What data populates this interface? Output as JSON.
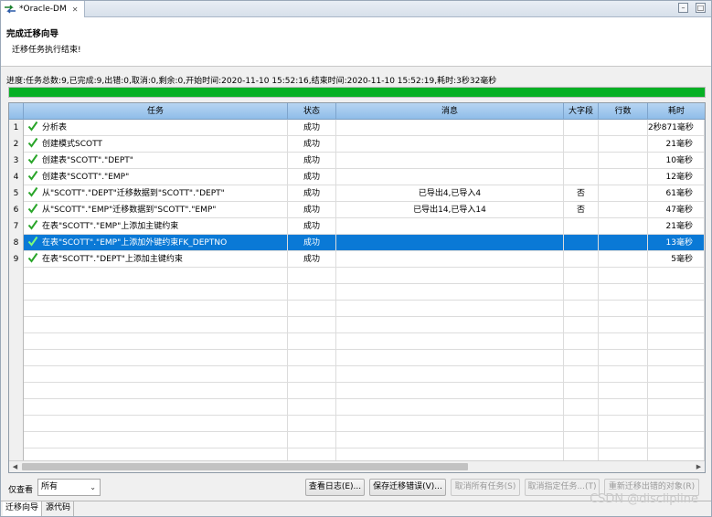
{
  "window": {
    "tab_title": "*Oracle-DM",
    "close_glyph": "✕",
    "minimize_glyph": "–",
    "maximize_glyph": "□"
  },
  "header": {
    "title": "完成迁移向导",
    "subtitle": "迁移任务执行结束!"
  },
  "progress": {
    "text": "进度:任务总数:9,已完成:9,出错:0,取消:0,剩余:0,开始时间:2020-11-10 15:52:16,结束时间:2020-11-10 15:52:19,耗时:3秒32毫秒",
    "fraction": 1.0,
    "color": "#06b025"
  },
  "table": {
    "columns": [
      "任务",
      "状态",
      "消息",
      "大字段",
      "行数",
      "耗时"
    ],
    "rows": [
      {
        "num": "1",
        "task": "分析表",
        "status": "成功",
        "message": "",
        "big": "",
        "rows": "",
        "time": "2秒871毫秒"
      },
      {
        "num": "2",
        "task": "创建模式SCOTT",
        "status": "成功",
        "message": "",
        "big": "",
        "rows": "",
        "time": "21毫秒"
      },
      {
        "num": "3",
        "task": "创建表\"SCOTT\".\"DEPT\"",
        "status": "成功",
        "message": "",
        "big": "",
        "rows": "",
        "time": "10毫秒"
      },
      {
        "num": "4",
        "task": "创建表\"SCOTT\".\"EMP\"",
        "status": "成功",
        "message": "",
        "big": "",
        "rows": "",
        "time": "12毫秒"
      },
      {
        "num": "5",
        "task": "从\"SCOTT\".\"DEPT\"迁移数据到\"SCOTT\".\"DEPT\"",
        "status": "成功",
        "message": "已导出4,已导入4",
        "big": "否",
        "rows": "",
        "time": "61毫秒"
      },
      {
        "num": "6",
        "task": "从\"SCOTT\".\"EMP\"迁移数据到\"SCOTT\".\"EMP\"",
        "status": "成功",
        "message": "已导出14,已导入14",
        "big": "否",
        "rows": "",
        "time": "47毫秒"
      },
      {
        "num": "7",
        "task": "在表\"SCOTT\".\"EMP\"上添加主键约束",
        "status": "成功",
        "message": "",
        "big": "",
        "rows": "",
        "time": "21毫秒"
      },
      {
        "num": "8",
        "task": "在表\"SCOTT\".\"EMP\"上添加外键约束FK_DEPTNO",
        "status": "成功",
        "message": "",
        "big": "",
        "rows": "",
        "time": "13毫秒",
        "selected": true
      },
      {
        "num": "9",
        "task": "在表\"SCOTT\".\"DEPT\"上添加主键约束",
        "status": "成功",
        "message": "",
        "big": "",
        "rows": "",
        "time": "5毫秒"
      }
    ],
    "empty_rows": 12
  },
  "controls": {
    "filter_label": "仅查看",
    "filter_value": "所有",
    "buttons": {
      "view_log": "查看日志(E)...",
      "save_errors": "保存迁移错误(V)...",
      "cancel_all": "取消所有任务(S)",
      "cancel_selected": "取消指定任务...(T)",
      "retry_failed": "重新迁移出错的对象(R)"
    }
  },
  "bottom_tabs": [
    "迁移向导",
    "源代码"
  ],
  "watermark": "CSDN @disclipline",
  "colors": {
    "success_check": "#2aa52a",
    "selection": "#0a79d6",
    "header_gradient": "#8fbde9"
  }
}
